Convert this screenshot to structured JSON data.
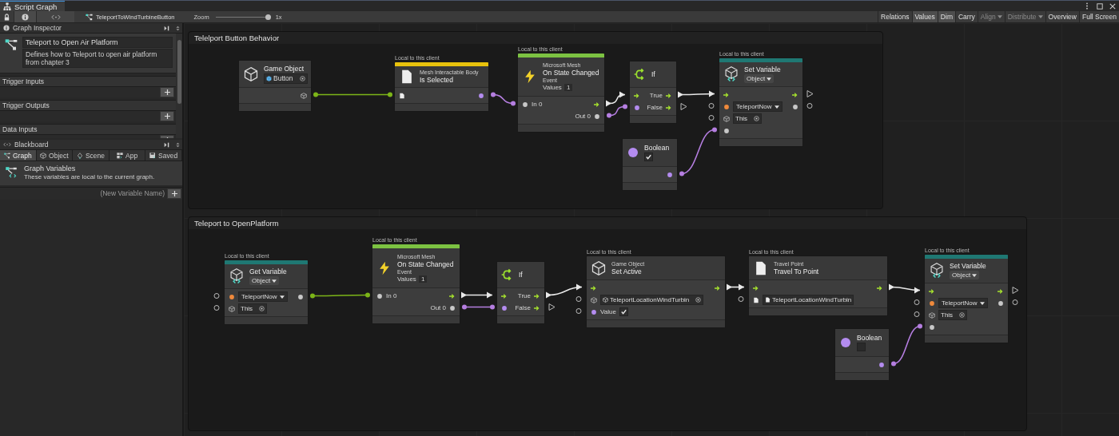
{
  "tab": {
    "title": "Script Graph"
  },
  "toolbar": {
    "breadcrumb": "TeleportToWindTurbineButton",
    "zoom_label": "Zoom",
    "zoom": {
      "level": 1
    },
    "zoom_reading": "1x",
    "buttons": [
      {
        "label": "Relations",
        "selected": false,
        "disabled": false,
        "dropdown": false
      },
      {
        "label": "Values",
        "selected": true,
        "disabled": false,
        "dropdown": false
      },
      {
        "label": "Dim",
        "selected": true,
        "disabled": false,
        "dropdown": false
      },
      {
        "label": "Carry",
        "selected": false,
        "disabled": false,
        "dropdown": false
      },
      {
        "label": "Align",
        "selected": false,
        "disabled": true,
        "dropdown": true
      },
      {
        "label": "Distribute",
        "selected": false,
        "disabled": true,
        "dropdown": true
      },
      {
        "label": "Overview",
        "selected": false,
        "disabled": false,
        "dropdown": false
      },
      {
        "label": "Full Screen",
        "selected": false,
        "disabled": false,
        "dropdown": false
      }
    ]
  },
  "inspector": {
    "header": "Graph Inspector",
    "title": "Teleport to Open Air Platform",
    "description": "Defines how to Teleport to open air platform from chapter 3",
    "sections": [
      {
        "label": "Trigger Inputs"
      },
      {
        "label": "Trigger Outputs"
      },
      {
        "label": "Data Inputs"
      }
    ]
  },
  "blackboard": {
    "header": "Blackboard",
    "tabs": [
      {
        "label": "Graph",
        "selected": true
      },
      {
        "label": "Object",
        "selected": false
      },
      {
        "label": "Scene",
        "selected": false
      },
      {
        "label": "App",
        "selected": false
      },
      {
        "label": "Saved",
        "selected": false
      }
    ],
    "title": "Graph Variables",
    "description": "These variables are local to the current graph.",
    "new_variable": {
      "placeholder": "(New Variable Name)"
    }
  },
  "groups": [
    {
      "title": "Telelport Button Behavior",
      "nodes": [
        {
          "kind": "literal",
          "title": "Game Object",
          "field": {
            "kind": "object",
            "value": "Button",
            "target": true
          },
          "rows": [
            {
              "out": {
                "kind": "object",
                "open": false
              }
            }
          ]
        },
        {
          "kind": "unit",
          "caption": "Local to this client",
          "color": "#e8c20c",
          "subtitle": "Mesh Interactable Body",
          "title": "Is Selected",
          "rows": [
            {
              "in": {
                "kind": "doc",
                "open": false
              },
              "out": {
                "kind": "bool",
                "open": false
              }
            }
          ]
        },
        {
          "kind": "event",
          "caption": "Local to this client",
          "color": "#7cc242",
          "subtitle": "Microsoft Mesh",
          "title": "On State Changed",
          "note": "Event",
          "values_label": "Values",
          "values": "1",
          "rows": [
            {
              "in": {
                "kind": "dot",
                "open": false
              },
              "label": "In 0",
              "out": {
                "kind": "flow",
                "open": false
              }
            },
            {
              "right_label": "Out 0",
              "out": {
                "kind": "dot",
                "open": false
              }
            }
          ]
        },
        {
          "kind": "if",
          "title": "If",
          "rows": [
            {
              "in": {
                "kind": "flow",
                "open": false
              },
              "right_label": "True",
              "out": {
                "kind": "flow",
                "open": false
              }
            },
            {
              "in": {
                "kind": "bool",
                "open": false
              },
              "right_label": "False",
              "out": {
                "kind": "flow",
                "open": true
              }
            }
          ]
        },
        {
          "kind": "variable",
          "caption": "Local to this client",
          "color": "#1f7873",
          "title": "Set Variable",
          "dropdown": "Object",
          "rows": [
            {
              "in": {
                "kind": "flow",
                "open": false
              },
              "out": {
                "kind": "flow",
                "open": true
              }
            },
            {
              "in": {
                "kind": "var",
                "open": true
              },
              "field": {
                "kind": "dropdown",
                "value": "TeleportNow"
              },
              "out": {
                "kind": "dot",
                "open": true
              }
            },
            {
              "in": {
                "kind": "object",
                "open": true
              },
              "field": {
                "kind": "object",
                "value": "This",
                "target": true
              }
            },
            {
              "in": {
                "kind": "dot",
                "open": false
              }
            }
          ]
        },
        {
          "kind": "boolean",
          "title": "Boolean",
          "checked": true,
          "rows": [
            {
              "out": {
                "kind": "bool",
                "open": false
              }
            }
          ]
        }
      ]
    },
    {
      "title": "Teleport to OpenPlatform",
      "nodes": [
        {
          "kind": "variable",
          "caption": "Local to this client",
          "color": "#1f7873",
          "title": "Get Variable",
          "dropdown": "Object",
          "rows": [
            {
              "in": {
                "kind": "var",
                "open": true
              },
              "field": {
                "kind": "dropdown",
                "value": "TeleportNow"
              },
              "out": {
                "kind": "dot",
                "open": false
              }
            },
            {
              "in": {
                "kind": "object",
                "open": true
              },
              "field": {
                "kind": "object",
                "value": "This",
                "target": true
              }
            }
          ]
        },
        {
          "kind": "event",
          "caption": "Local to this client",
          "color": "#7cc242",
          "subtitle": "Microsoft Mesh",
          "title": "On State Changed",
          "note": "Event",
          "values_label": "Values",
          "values": "1",
          "rows": [
            {
              "in": {
                "kind": "dot",
                "open": false
              },
              "label": "In 0",
              "out": {
                "kind": "flow",
                "open": false
              }
            },
            {
              "right_label": "Out 0",
              "out": {
                "kind": "dot",
                "open": false
              }
            }
          ]
        },
        {
          "kind": "if",
          "title": "If",
          "rows": [
            {
              "in": {
                "kind": "flow",
                "open": false
              },
              "right_label": "True",
              "out": {
                "kind": "flow",
                "open": false
              }
            },
            {
              "in": {
                "kind": "bool",
                "open": false
              },
              "right_label": "False",
              "out": {
                "kind": "flow",
                "open": true
              }
            }
          ]
        },
        {
          "kind": "unit",
          "caption": "Local to this client",
          "subtitle": "Game Object",
          "title": "Set Active",
          "rows": [
            {
              "in": {
                "kind": "flow",
                "open": false
              },
              "out": {
                "kind": "flow",
                "open": false
              }
            },
            {
              "in": {
                "kind": "object",
                "open": true
              },
              "field": {
                "kind": "object",
                "value": "TeleportLocationWindTurbin",
                "target": true
              }
            },
            {
              "in": {
                "kind": "bool",
                "open": true
              },
              "label": "Value",
              "field": {
                "kind": "checkbox",
                "checked": true
              }
            }
          ]
        },
        {
          "kind": "unit",
          "caption": "Local to this client",
          "subtitle": "Travel Point",
          "title": "Travel To Point",
          "rows": [
            {
              "in": {
                "kind": "flow",
                "open": false
              },
              "out": {
                "kind": "flow",
                "open": false
              }
            },
            {
              "in": {
                "kind": "doc",
                "open": true
              },
              "field": {
                "kind": "object",
                "value": "TeleportLocationWindTurbin"
              }
            }
          ]
        },
        {
          "kind": "variable",
          "caption": "Local to this client",
          "color": "#1f7873",
          "title": "Set Variable",
          "dropdown": "Object",
          "rows": [
            {
              "in": {
                "kind": "flow",
                "open": false
              },
              "out": {
                "kind": "flow",
                "open": true
              }
            },
            {
              "in": {
                "kind": "var",
                "open": true
              },
              "field": {
                "kind": "dropdown",
                "value": "TeleportNow"
              },
              "out": {
                "kind": "dot",
                "open": true
              }
            },
            {
              "in": {
                "kind": "object",
                "open": true
              },
              "field": {
                "kind": "object",
                "value": "This",
                "target": true
              }
            },
            {
              "in": {
                "kind": "dot",
                "open": false
              }
            }
          ]
        },
        {
          "kind": "boolean",
          "title": "Boolean",
          "checked": false,
          "rows": [
            {
              "out": {
                "kind": "bool",
                "open": false
              }
            }
          ]
        }
      ]
    }
  ]
}
